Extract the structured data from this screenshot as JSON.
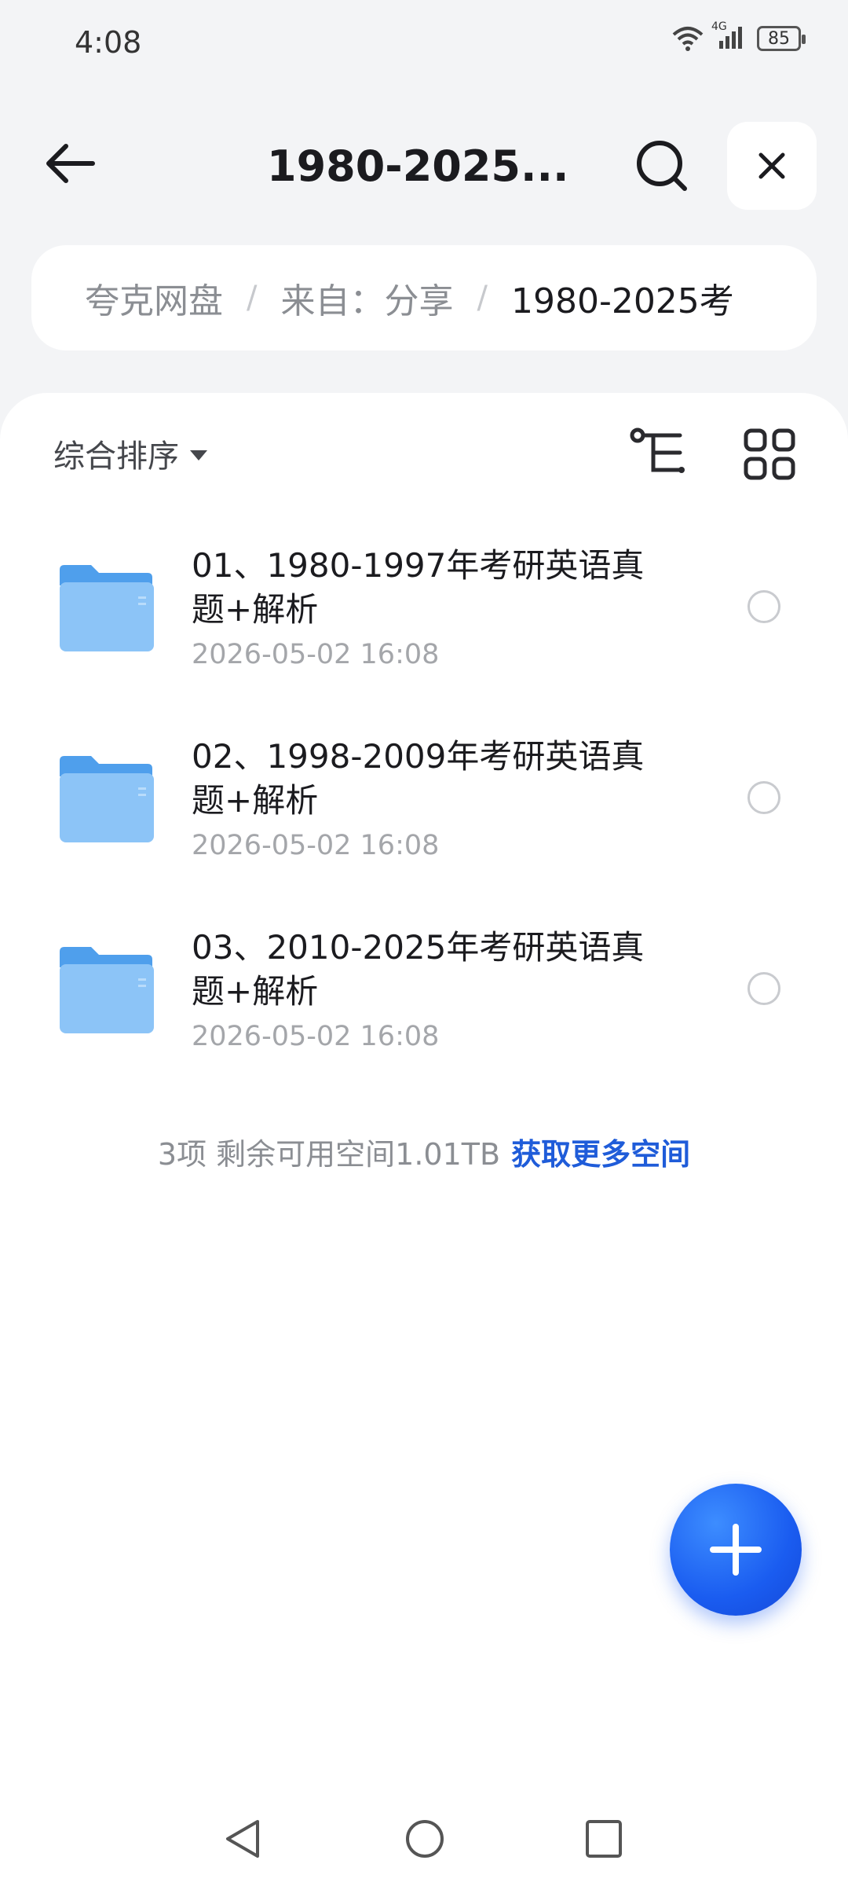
{
  "status_bar": {
    "time": "4:08",
    "network": "4G",
    "battery": "85"
  },
  "header": {
    "title": "1980-2025...",
    "back_icon": "arrow-left-icon",
    "search_icon": "search-icon",
    "close_icon": "close-icon"
  },
  "breadcrumb": [
    {
      "label": "夸克网盘"
    },
    {
      "label": "来自：分享"
    },
    {
      "label": "1980-2025考"
    }
  ],
  "toolbar": {
    "sort_label": "综合排序",
    "tree_icon": "tree-view-icon",
    "grid_icon": "grid-view-icon"
  },
  "files": [
    {
      "name": "01、1980-1997年考研英语真题+解析",
      "date": "2026-05-02 16:08",
      "icon": "folder-icon"
    },
    {
      "name": "02、1998-2009年考研英语真题+解析",
      "date": "2026-05-02 16:08",
      "icon": "folder-icon"
    },
    {
      "name": "03、2010-2025年考研英语真题+解析",
      "date": "2026-05-02 16:08",
      "icon": "folder-icon"
    }
  ],
  "footer": {
    "summary": "3项 剩余可用空间1.01TB",
    "more_space_link": "获取更多空间"
  },
  "fab": {
    "icon": "plus-icon"
  },
  "colors": {
    "accent": "#1f5cd9",
    "fab": "#1a5cf0",
    "background": "#f3f4f6",
    "folder": "#8cc4f7"
  }
}
